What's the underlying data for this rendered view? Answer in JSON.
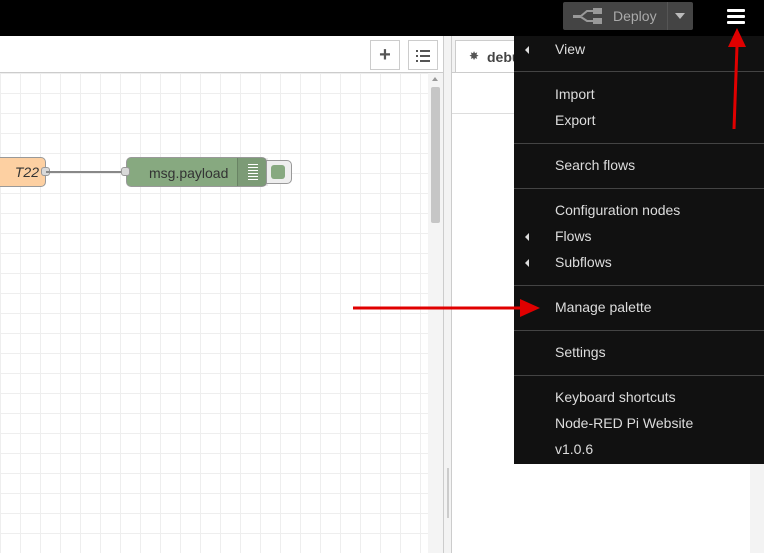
{
  "header": {
    "deploy_label": "Deploy"
  },
  "workspace": {
    "add_flow_symbol": "+",
    "nodes": [
      {
        "label": "T22",
        "color": "#fdd0a2"
      },
      {
        "label": "msg.payload",
        "color": "#87a980"
      }
    ]
  },
  "sidebar": {
    "tab_label": "debu"
  },
  "menu": {
    "sections": [
      [
        {
          "label": "View",
          "submenu": true
        }
      ],
      [
        {
          "label": "Import",
          "submenu": false
        },
        {
          "label": "Export",
          "submenu": false
        }
      ],
      [
        {
          "label": "Search flows",
          "submenu": false
        }
      ],
      [
        {
          "label": "Configuration nodes",
          "submenu": false
        },
        {
          "label": "Flows",
          "submenu": true
        },
        {
          "label": "Subflows",
          "submenu": true
        }
      ],
      [
        {
          "label": "Manage palette",
          "submenu": false
        }
      ],
      [
        {
          "label": "Settings",
          "submenu": false
        }
      ],
      [
        {
          "label": "Keyboard shortcuts",
          "submenu": false
        },
        {
          "label": "Node-RED Pi Website",
          "submenu": false
        },
        {
          "label": "v1.0.6",
          "submenu": false
        }
      ]
    ]
  },
  "colors": {
    "header_bg": "#000000",
    "menu_bg": "#111111",
    "annotation_arrow": "#e00000"
  },
  "icons": [
    "deploy-icon",
    "caret-down-icon",
    "hamburger-menu-icon",
    "list-icon",
    "bug-icon",
    "submenu-arrow-icon"
  ]
}
